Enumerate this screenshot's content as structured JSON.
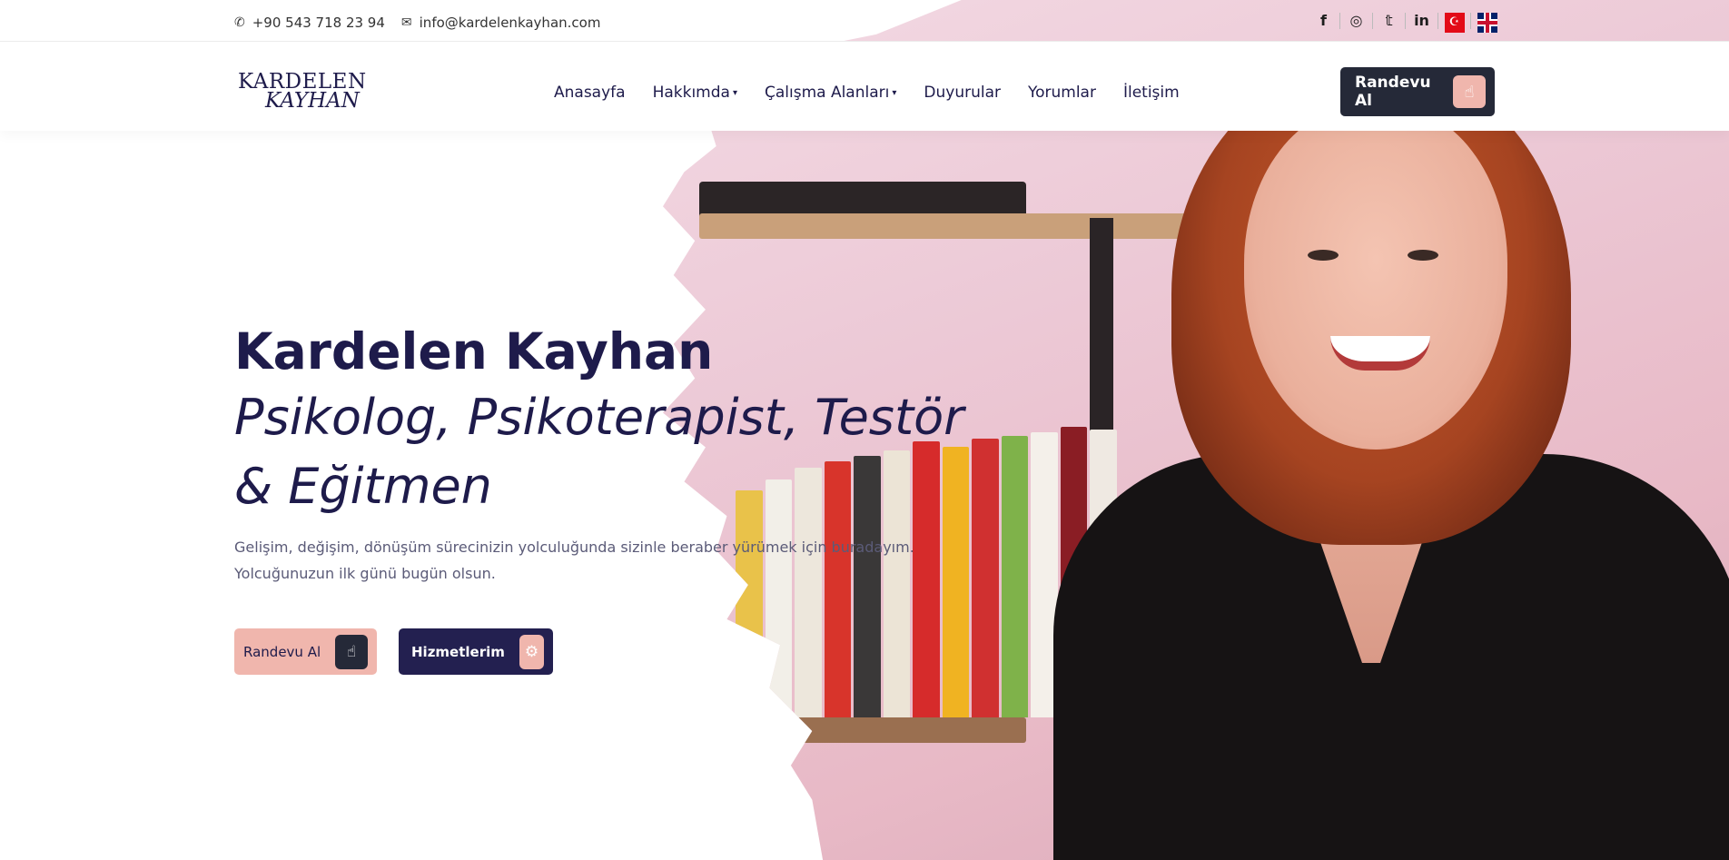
{
  "topbar": {
    "phone": "+90 543 718 23 94",
    "email": "info@kardelenkayhan.com",
    "phone_icon": "phone-icon",
    "email_icon": "mail-icon",
    "social": [
      {
        "name": "facebook-icon",
        "glyph": "f"
      },
      {
        "name": "instagram-icon",
        "glyph": "◎"
      },
      {
        "name": "twitter-icon",
        "glyph": "𝕥"
      },
      {
        "name": "linkedin-icon",
        "glyph": "in"
      }
    ],
    "languages": [
      "Türkçe",
      "English"
    ],
    "tr_flag_glyph": "☪"
  },
  "logo": {
    "line1": "KARDELEN",
    "line2": "KAYHAN"
  },
  "nav": {
    "items": [
      {
        "label": "Anasayfa",
        "dropdown": false
      },
      {
        "label": "Hakkımda",
        "dropdown": true
      },
      {
        "label": "Çalışma Alanları",
        "dropdown": true
      },
      {
        "label": "Duyurular",
        "dropdown": false
      },
      {
        "label": "Yorumlar",
        "dropdown": false
      },
      {
        "label": "İletişim",
        "dropdown": false
      }
    ],
    "cta_label": "Randevu Al",
    "caret_glyph": "▾"
  },
  "hero": {
    "name": "Kardelen Kayhan",
    "role_line1": "Psikolog, Psikoterapist, Testör",
    "role_line2": "& Eğitmen",
    "desc_line1": "Gelişim, değişim, dönüşüm sürecinizin yolculuğunda sizinle beraber yürümek için buradayım.",
    "desc_line2": "Yolcuğunuzun ilk günü bugün olsun.",
    "btn_primary": "Randevu Al",
    "btn_secondary": "Hizmetlerim",
    "hand_glyph": "☝",
    "gear_glyph": "⚙"
  },
  "colors": {
    "navy": "#1e1b4b",
    "accent_pink": "#f0b6ad",
    "dark_button": "#252938",
    "secondary_button": "#232050"
  }
}
